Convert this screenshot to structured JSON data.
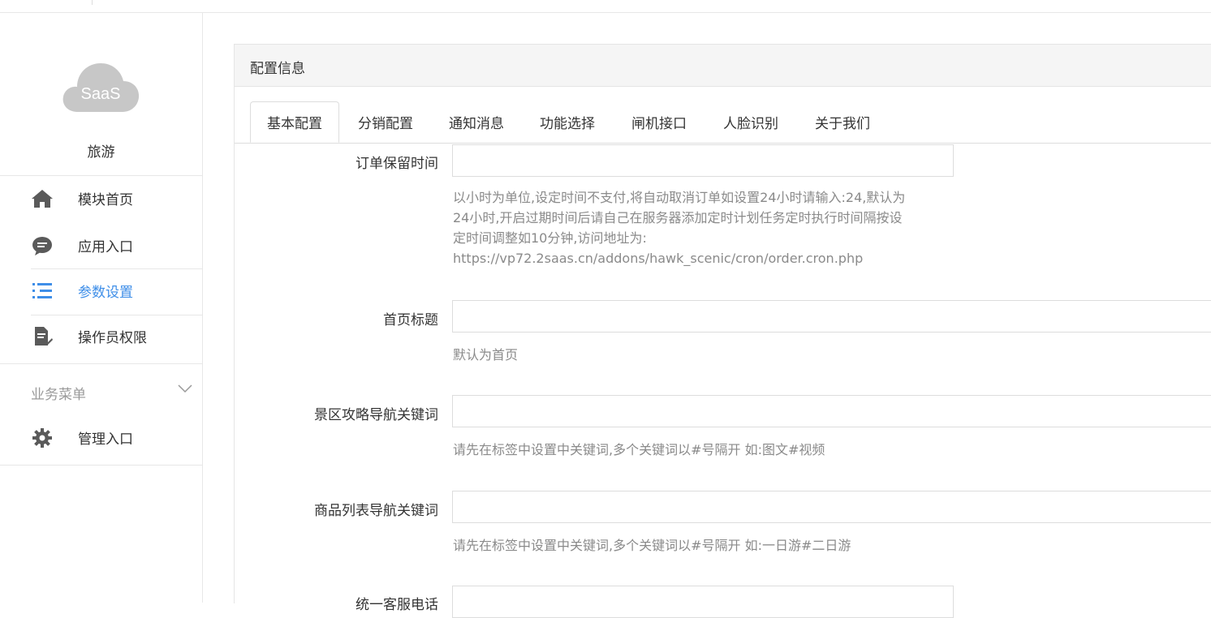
{
  "sidebar": {
    "logo_text": "SaaS",
    "app_name": "旅游",
    "items": [
      {
        "label": "模块首页",
        "icon": "home-icon"
      },
      {
        "label": "应用入口",
        "icon": "chat-bubble-icon"
      },
      {
        "label": "参数设置",
        "icon": "list-settings-icon",
        "active": true
      },
      {
        "label": "操作员权限",
        "icon": "document-edit-icon"
      }
    ],
    "section": {
      "label": "业务菜单"
    },
    "section_items": [
      {
        "label": "管理入口",
        "icon": "gear-icon"
      }
    ],
    "active_color": "#3e8ee8"
  },
  "panel": {
    "title": "配置信息",
    "tabs": [
      "基本配置",
      "分销配置",
      "通知消息",
      "功能选择",
      "闸机接口",
      "人脸识别",
      "关于我们"
    ],
    "active_tab": "基本配置"
  },
  "form": {
    "order_keep": {
      "label": "订单保留时间",
      "value": "",
      "help": [
        "以小时为单位,设定时间不支付,将自动取消订单如设置24小时请输入:24,默认为",
        "24小时,开启过期时间后请自己在服务器添加定时计划任务定时执行时间隔按设",
        "定时间调整如10分钟,访问地址为:",
        "https://vp72.2saas.cn/addons/hawk_scenic/cron/order.cron.php"
      ]
    },
    "home_title": {
      "label": "首页标题",
      "value": "",
      "help": "默认为首页"
    },
    "scenic_keywords": {
      "label": "景区攻略导航关键词",
      "value": "",
      "help": "请先在标签中设置中关键词,多个关键词以#号隔开 如:图文#视频"
    },
    "goods_keywords": {
      "label": "商品列表导航关键词",
      "value": "",
      "help": "请先在标签中设置中关键词,多个关键词以#号隔开 如:一日游#二日游"
    },
    "service_phone": {
      "label": "统一客服电话",
      "value": ""
    }
  }
}
